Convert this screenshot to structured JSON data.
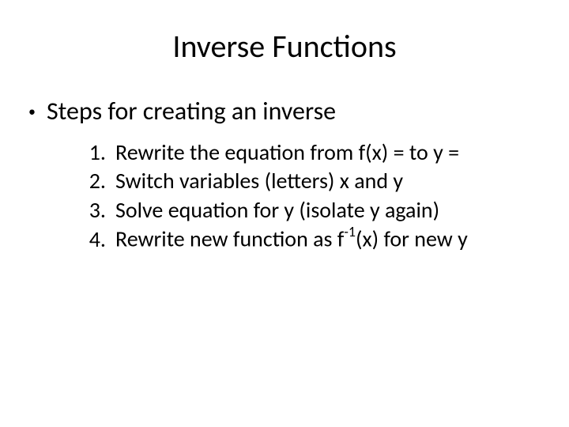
{
  "title": "Inverse Functions",
  "main_bullet": "Steps for creating an inverse",
  "steps": [
    {
      "num": "1.",
      "text": "Rewrite the equation from f(x) = to y ="
    },
    {
      "num": "2.",
      "text": "Switch variables (letters) x and y"
    },
    {
      "num": "3.",
      "text": "Solve equation for y (isolate y again)"
    },
    {
      "num": "4.",
      "text_pre": "Rewrite new function as f",
      "sup": "-1",
      "text_post": "(x) for new y"
    }
  ]
}
